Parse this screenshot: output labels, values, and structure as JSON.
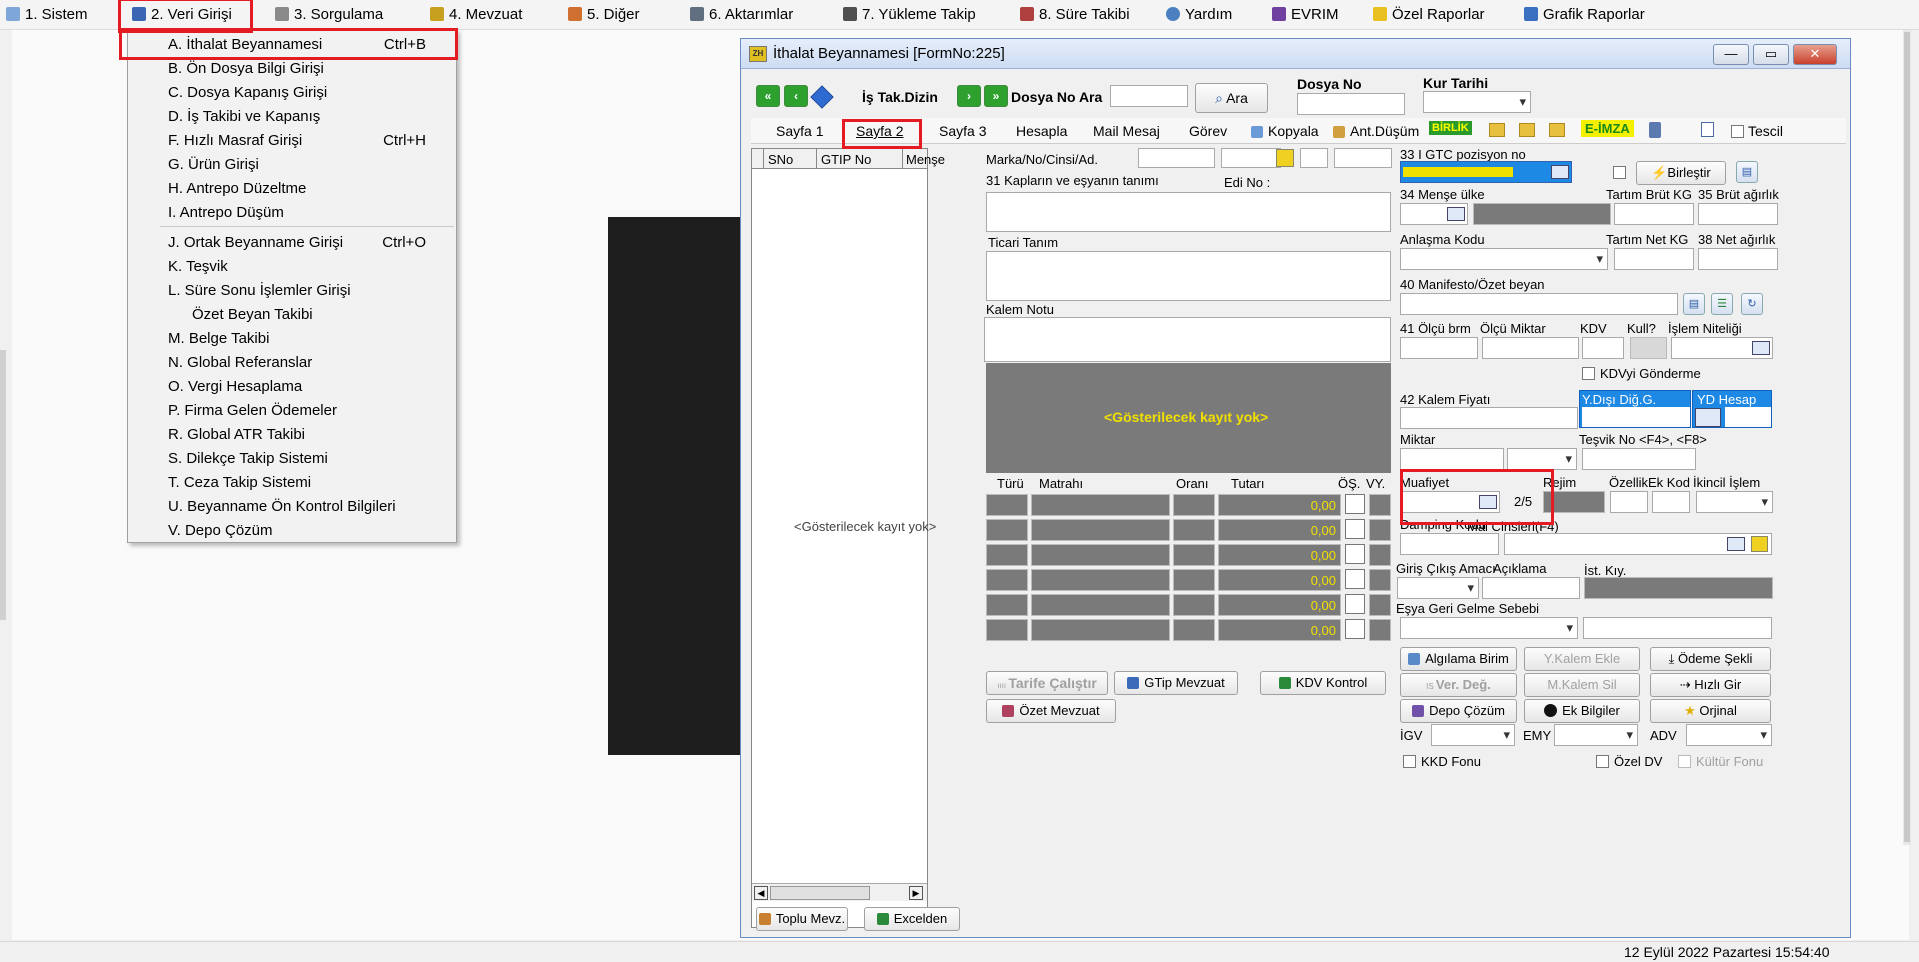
{
  "menubar": {
    "items": [
      "1.  Sistem",
      "2.  Veri Girişi",
      "3.  Sorgulama",
      "4.  Mevzuat",
      "5.  Diğer",
      "6.  Aktarımlar",
      "7.  Yükleme Takip",
      "8. Süre Takibi",
      "Yardım",
      "EVRIM",
      "Özel Raporlar",
      "Grafik Raporlar"
    ]
  },
  "dropdown": {
    "items": [
      {
        "label": "A.  İthalat Beyannamesi",
        "key": "Ctrl+B"
      },
      {
        "label": "B.  Ön Dosya Bilgi Girişi",
        "key": ""
      },
      {
        "label": "C.  Dosya Kapanış Girişi",
        "key": ""
      },
      {
        "label": "D.  İş Takibi ve Kapanış",
        "key": ""
      },
      {
        "label": "F.  Hızlı Masraf Girişi",
        "key": "Ctrl+H"
      },
      {
        "label": "G.  Ürün Girişi",
        "key": ""
      },
      {
        "label": "H.  Antrepo Düzeltme",
        "key": ""
      },
      {
        "label": "I.   Antrepo Düşüm",
        "key": ""
      },
      {
        "label": "J.  Ortak Beyanname Girişi",
        "key": "Ctrl+O"
      },
      {
        "label": "K.  Teşvik",
        "key": ""
      },
      {
        "label": "L.  Süre Sonu İşlemler Girişi",
        "key": ""
      },
      {
        "label": "Özet Beyan Takibi",
        "key": ""
      },
      {
        "label": "M.  Belge Takibi",
        "key": ""
      },
      {
        "label": "N.  Global Referanslar",
        "key": ""
      },
      {
        "label": "O. Vergi Hesaplama",
        "key": ""
      },
      {
        "label": "P. Firma Gelen Ödemeler",
        "key": ""
      },
      {
        "label": "R. Global ATR Takibi",
        "key": ""
      },
      {
        "label": "S. Dilekçe Takip Sistemi",
        "key": ""
      },
      {
        "label": "T. Ceza Takip Sistemi",
        "key": ""
      },
      {
        "label": "U. Beyanname Ön Kontrol Bilgileri",
        "key": ""
      },
      {
        "label": "V. Depo Çözüm",
        "key": ""
      }
    ]
  },
  "window": {
    "title": "İthalat Beyannamesi [FormNo:225]",
    "minimize": "—",
    "maximize": "▭",
    "close": "✕"
  },
  "toolbar": {
    "is_tak_dizin": "İş Tak.Dizin",
    "dosya_no_ara": "Dosya No Ara",
    "ara": "Ara",
    "dosya_no": "Dosya No",
    "kur_tarihi": "Kur Tarihi"
  },
  "tabs": [
    "Sayfa 1",
    "Sayfa 2",
    "Sayfa 3",
    "Hesapla",
    "Mail Mesaj",
    "Görev",
    "Kopyala",
    "Ant.Düşüm",
    "BİRLİK",
    "E-İMZA",
    "Tescil"
  ],
  "grid": {
    "columns": [
      "SNo",
      "GTIP No",
      "Menşe"
    ],
    "empty": "<Gösterilecek kayıt yok>",
    "toplu_mevz": "Toplu Mevz.",
    "excelden": "Excelden"
  },
  "mid": {
    "marka": "Marka/No/Cinsi/Ad.",
    "kaplar": "31 Kapların ve eşyanın tanımı",
    "edi_no": "Edi No :",
    "ticari_tanim": "Ticari Tanım",
    "kalem_notu": "Kalem Notu",
    "empty": "<Gösterilecek kayıt yok>",
    "tax_cols": [
      "Türü",
      "Matrahı",
      "Oranı",
      "Tutarı",
      "ÖŞ.",
      "VY."
    ],
    "tax_values": [
      "0,00",
      "0,00",
      "0,00",
      "0,00",
      "0,00",
      "0,00"
    ],
    "tarife": "Tarife Çalıştır",
    "gtip_mevzuat": "GTip Mevzuat",
    "kdv_kontrol": "KDV Kontrol",
    "ozet_mevzuat": "Özet Mevzuat"
  },
  "right": {
    "gtc": "33 I GTC pozisyon no",
    "birlestir": "Birleştir",
    "mense": "34 Menşe ülke",
    "tartim_brut": "Tartım Brüt KG",
    "brut_agirlik": "35 Brüt ağırlık",
    "anlasma": "Anlaşma Kodu",
    "tartim_net": "Tartım Net KG",
    "net_agirlik": "38 Net ağırlık",
    "manifesto": "40 Manifesto/Özet beyan",
    "olcu_brm": "41 Ölçü brm",
    "olcu_miktar": "Ölçü Miktar",
    "kdv": "KDV",
    "kull": "Kull?",
    "islem_niteligi": "İşlem Niteliği",
    "kdvyi": "KDVyi Gönderme",
    "kalem_fiyati": "42 Kalem Fiyatı",
    "ydisi": "Y.Dışı Diğ.G.",
    "yd_hesap": "YD Hesap",
    "miktar": "Miktar",
    "tesvik": "Teşvik No <F4>, <F8>",
    "muafiyet": "Muafiyet",
    "rejim": "Rejim",
    "ozellik": "ÖzellikEk Kod",
    "ikincil": "İkincil İşlem",
    "muaf_count": "2/5",
    "damping": "Damping Kodu",
    "mal_cinsleri": "Mal Cinsleri(F4)",
    "giris_cikis": "Giriş Çıkış Amacı",
    "aciklama": "Açıklama",
    "ist_kiy": "İst. Kıy.",
    "esya_geri": "Eşya Geri Gelme Sebebi",
    "algilama": "Algılama Birim",
    "y_kalem_ekle": "Y.Kalem Ekle",
    "odeme_sekli": "Ödeme Şekli",
    "ver_deg": "Ver. Değ.",
    "m_kalem_sil": "M.Kalem Sil",
    "hizli_gir": "Hızlı Gir",
    "depo_cozum": "Depo Çözüm",
    "ek_bilgiler": "Ek Bilgiler",
    "orjinal": "Orjinal",
    "igv": "İGV",
    "emy": "EMY",
    "adv": "ADV",
    "kkd": "KKD Fonu",
    "ozel_dv": "Özel DV",
    "kultur": "Kültür Fonu"
  },
  "status": {
    "datetime": "12 Eylül 2022 Pazartesi 15:54:40"
  },
  "colors": {
    "highlight": "#e41b23",
    "selection_blue": "#1e88e5",
    "dark_gray": "#7a7a7a",
    "yellow_text": "#f0e000"
  }
}
